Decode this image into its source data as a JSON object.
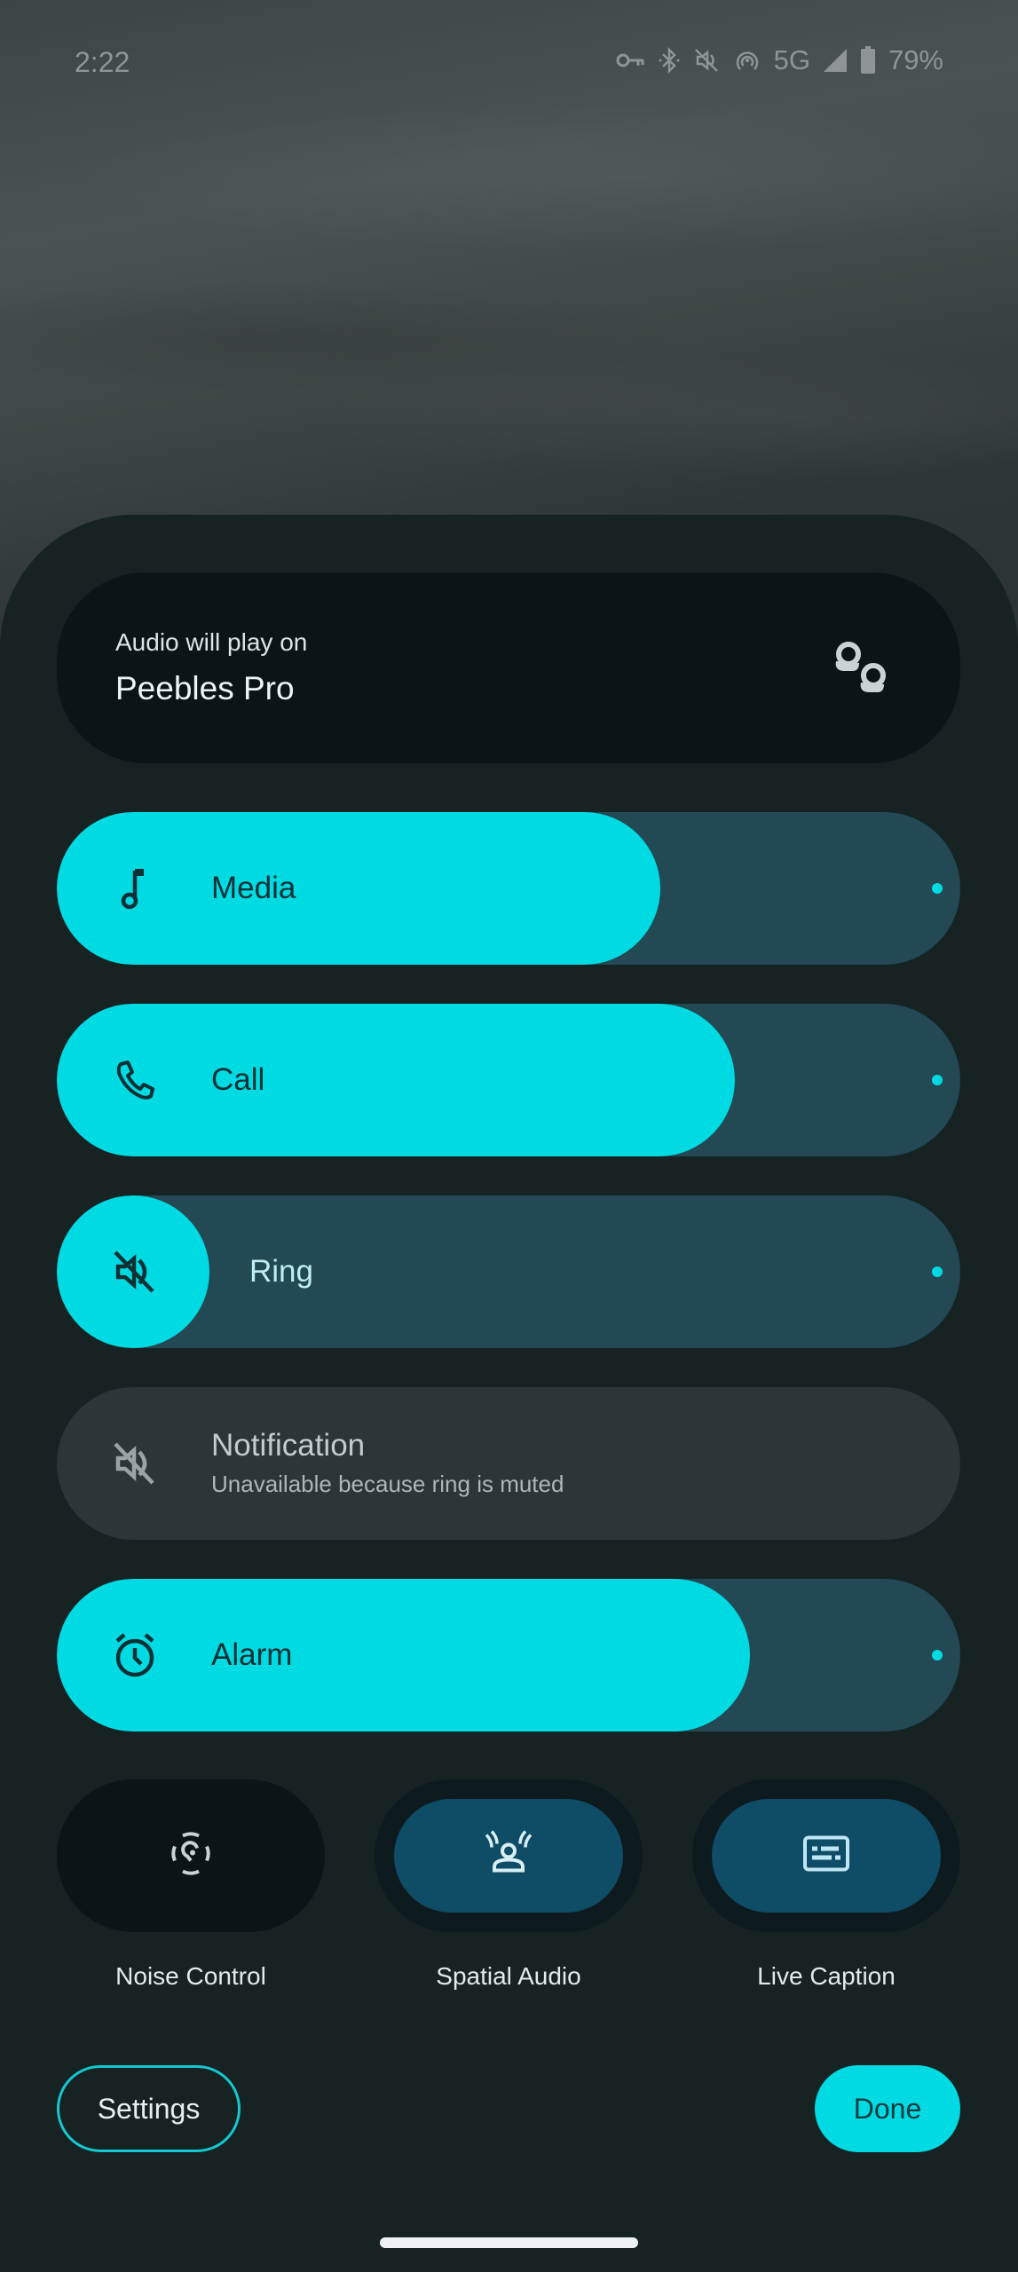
{
  "status_bar": {
    "time": "2:22",
    "icons": [
      "vpn-key-icon",
      "bluetooth-icon",
      "muted-icon",
      "hotspot-icon"
    ],
    "network": "5G",
    "battery": "79%"
  },
  "output": {
    "subtitle": "Audio will play on",
    "device_name": "Peebles Pro",
    "icon": "earbuds-icon"
  },
  "sliders": [
    {
      "label": "Media",
      "icon": "music-note-icon",
      "level_percent": 60
    },
    {
      "label": "Call",
      "icon": "phone-icon",
      "level_percent": 70
    },
    {
      "label": "Ring",
      "icon": "volume-off-icon",
      "level_percent": 0,
      "muted": true
    },
    {
      "label": "Notification",
      "sublabel": "Unavailable because ring is muted",
      "icon": "volume-off-icon",
      "disabled": true
    },
    {
      "label": "Alarm",
      "icon": "alarm-icon",
      "level_percent": 72
    }
  ],
  "toggles": [
    {
      "label": "Noise Control",
      "icon": "noise-control-icon",
      "active": false
    },
    {
      "label": "Spatial Audio",
      "icon": "spatial-audio-icon",
      "active": true
    },
    {
      "label": "Live Caption",
      "icon": "live-caption-icon",
      "active": true
    }
  ],
  "buttons": {
    "settings": "Settings",
    "done": "Done"
  },
  "colors": {
    "accent": "#00dbe3",
    "panel_bg": "#172222",
    "track": "#224954",
    "toggle_on": "#0f4c66"
  }
}
